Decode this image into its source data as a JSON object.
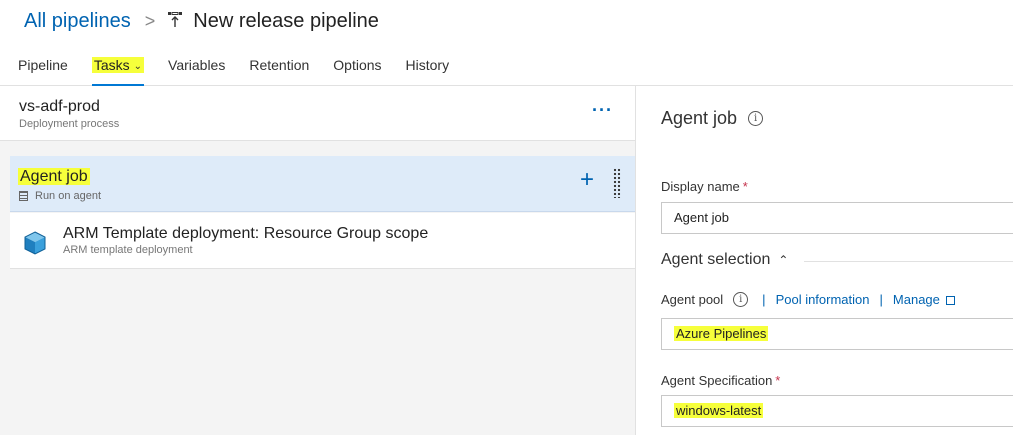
{
  "breadcrumb": {
    "root": "All pipelines",
    "separator": ">",
    "title": "New release pipeline"
  },
  "tabs": [
    {
      "label": "Pipeline"
    },
    {
      "label": "Tasks",
      "active": true
    },
    {
      "label": "Variables"
    },
    {
      "label": "Retention"
    },
    {
      "label": "Options"
    },
    {
      "label": "History"
    }
  ],
  "stage": {
    "name": "vs-adf-prod",
    "subtitle": "Deployment process",
    "more_label": "···"
  },
  "job": {
    "title": "Agent job",
    "subtitle": "Run on agent",
    "add_label": "+"
  },
  "task": {
    "title": "ARM Template deployment: Resource Group scope",
    "subtitle": "ARM template deployment"
  },
  "panel": {
    "title": "Agent job",
    "display_name_label": "Display name",
    "display_name_value": "Agent job",
    "required_mark": "*",
    "agent_selection_label": "Agent selection",
    "agent_pool_label": "Agent pool",
    "pool_info_link": "Pool information",
    "manage_link": "Manage",
    "link_separator": "|",
    "agent_pool_value": "Azure Pipelines",
    "agent_spec_label": "Agent Specification",
    "agent_spec_value": "windows-latest"
  },
  "colors": {
    "accent": "#0078d4",
    "link": "#0063b1",
    "highlight": "#f6ff3b",
    "selected_row": "#deebf9",
    "required": "#c4314b"
  }
}
